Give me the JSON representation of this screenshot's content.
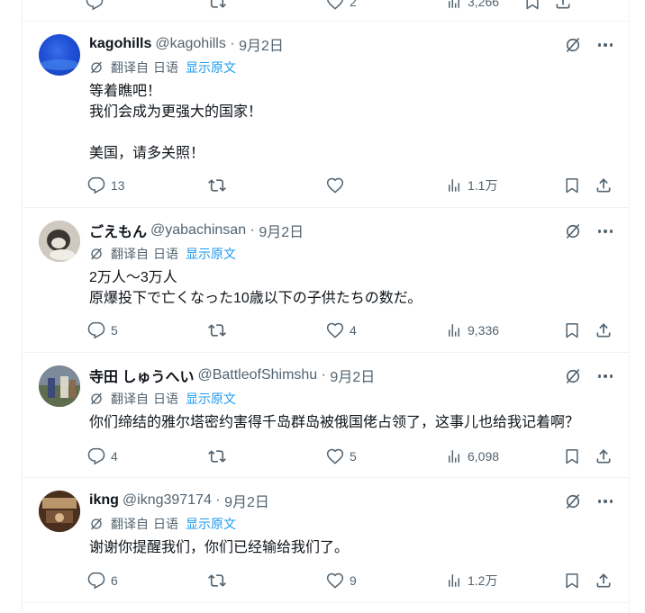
{
  "common": {
    "translated_from": "翻译自",
    "source_language": "日语",
    "show_original": "显示原文",
    "icons": {
      "reply": "reply-icon",
      "retweet": "retweet-icon",
      "like": "like-icon",
      "views": "views-icon",
      "bookmark": "bookmark-icon",
      "share": "share-icon",
      "grok": "grok-icon",
      "more": "more-icon",
      "translate": "translate-icon"
    },
    "colors": {
      "text": "#0f1419",
      "secondary": "#536471",
      "link": "#1d9bf0",
      "divider": "#eff3f4"
    }
  },
  "top_partial": {
    "likes": "2",
    "views": "3,266"
  },
  "tweets": [
    {
      "name": "kagohills",
      "handle": "@kagohills",
      "date": "9月2日",
      "lines": [
        "等着瞧吧！",
        "我们会成为更强大的国家！",
        "",
        "美国，请多关照！"
      ],
      "replies": "13",
      "retweets": "",
      "likes": "",
      "views": "1.1万"
    },
    {
      "name": "ごえもん",
      "handle": "@yabachinsan",
      "date": "9月2日",
      "lines": [
        "2万人～3万人",
        "原爆投下で亡くなった10歳以下の子供たちの数だ。"
      ],
      "replies": "5",
      "retweets": "",
      "likes": "4",
      "views": "9,336"
    },
    {
      "name": "寺田 しゅうへい",
      "handle": "@BattleofShimshu",
      "date": "9月2日",
      "lines": [
        "你们缔结的雅尔塔密约害得千岛群岛被俄国佬占领了，这事儿也给我记着啊？"
      ],
      "replies": "4",
      "retweets": "",
      "likes": "5",
      "views": "6,098"
    },
    {
      "name": "ikng",
      "handle": "@ikng397174",
      "date": "9月2日",
      "lines": [
        "谢谢你提醒我们，你们已经输给我们了。"
      ],
      "replies": "6",
      "retweets": "",
      "likes": "9",
      "views": "1.2万"
    }
  ]
}
